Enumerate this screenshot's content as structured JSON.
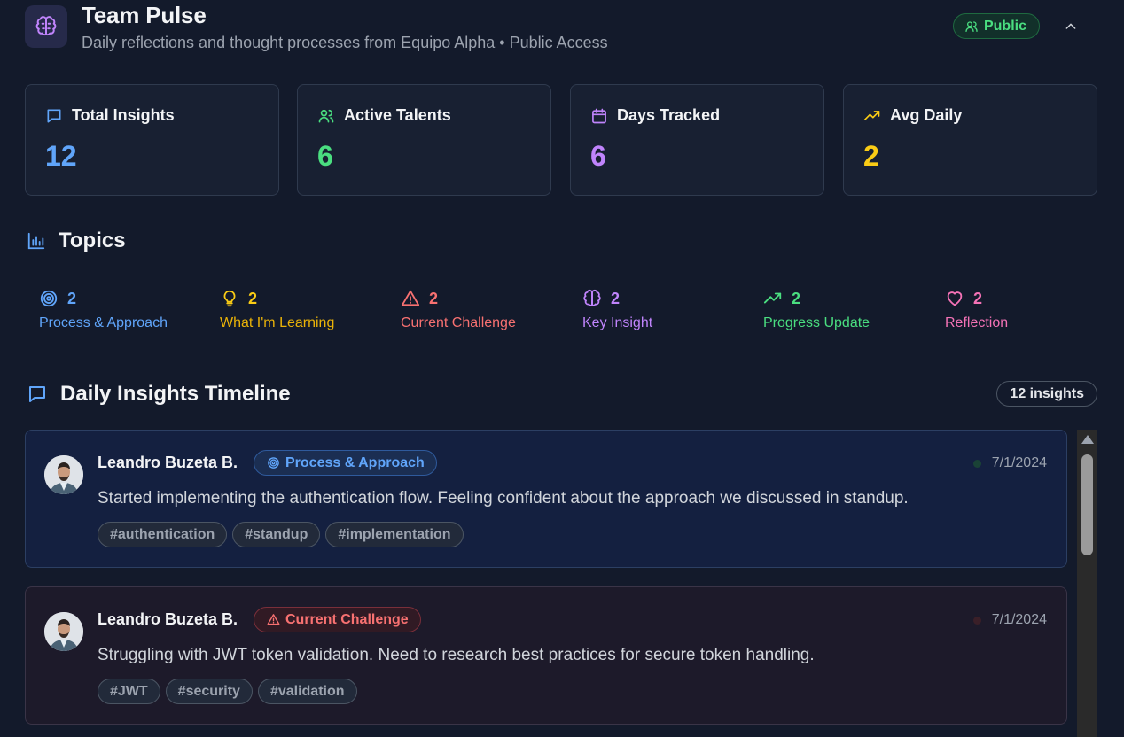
{
  "header": {
    "title": "Team Pulse",
    "subtitle": "Daily reflections and thought processes from Equipo Alpha • Public Access",
    "visibility_label": "Public"
  },
  "stats": [
    {
      "label": "Total Insights",
      "value": "12",
      "icon": "message-square-icon",
      "color": "#60a5fa"
    },
    {
      "label": "Active Talents",
      "value": "6",
      "icon": "users-icon",
      "color": "#4ade80"
    },
    {
      "label": "Days Tracked",
      "value": "6",
      "icon": "calendar-icon",
      "color": "#c084fc"
    },
    {
      "label": "Avg Daily",
      "value": "2",
      "icon": "trending-up-icon",
      "color": "#facc15"
    }
  ],
  "topics_section": {
    "title": "Topics",
    "items": [
      {
        "label": "Process & Approach",
        "count": "2",
        "icon": "target-icon",
        "color": "#60a5fa"
      },
      {
        "label": "What I'm Learning",
        "count": "2",
        "icon": "lightbulb-icon",
        "color": "#facc15"
      },
      {
        "label": "Current Challenge",
        "count": "2",
        "icon": "alert-triangle-icon",
        "color": "#f87171"
      },
      {
        "label": "Key Insight",
        "count": "2",
        "icon": "brain-icon",
        "color": "#c084fc"
      },
      {
        "label": "Progress Update",
        "count": "2",
        "icon": "trending-up-icon",
        "color": "#4ade80"
      },
      {
        "label": "Reflection",
        "count": "2",
        "icon": "heart-icon",
        "color": "#f472b6"
      }
    ]
  },
  "timeline": {
    "title": "Daily Insights Timeline",
    "count_label": "12 insights",
    "entries": [
      {
        "author": "Leandro Buzeta B.",
        "category": "Process & Approach",
        "date": "7/1/2024",
        "text": "Started implementing the authentication flow. Feeling confident about the approach we discussed in standup.",
        "tags": [
          "#authentication",
          "#standup",
          "#implementation"
        ]
      },
      {
        "author": "Leandro Buzeta B.",
        "category": "Current Challenge",
        "date": "7/1/2024",
        "text": "Struggling with JWT token validation. Need to research best practices for secure token handling.",
        "tags": [
          "#JWT",
          "#security",
          "#validation"
        ]
      }
    ]
  }
}
